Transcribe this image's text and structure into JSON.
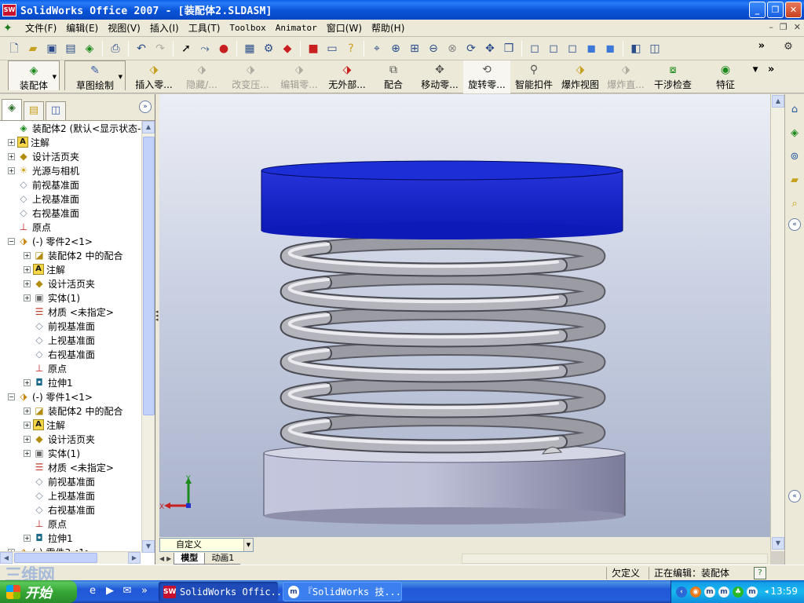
{
  "window": {
    "app_icon": "SW",
    "title": "SolidWorks Office 2007 - [装配体2.SLDASM]",
    "controls": [
      "minimize-icon",
      "restore-icon",
      "close-icon"
    ]
  },
  "menubar": {
    "items": [
      "文件(F)",
      "编辑(E)",
      "视图(V)",
      "插入(I)",
      "工具(T)",
      "Toolbox",
      "Animator",
      "窗口(W)",
      "帮助(H)"
    ]
  },
  "command_manager": {
    "tabs": [
      {
        "label": "装配体",
        "icon": "assembly-icon"
      },
      {
        "label": "草图绘制",
        "icon": "sketch-icon"
      }
    ],
    "commands": [
      {
        "label": "插入零...",
        "icon": "insert-component-icon",
        "enabled": true
      },
      {
        "label": "隐藏/...",
        "icon": "hide-show-icon",
        "enabled": false
      },
      {
        "label": "改变压...",
        "icon": "change-suppression-icon",
        "enabled": false
      },
      {
        "label": "编辑零...",
        "icon": "edit-component-icon",
        "enabled": false
      },
      {
        "label": "无外部...",
        "icon": "no-external-refs-icon",
        "enabled": true
      },
      {
        "label": "配合",
        "icon": "mate-icon",
        "enabled": true
      },
      {
        "label": "移动零...",
        "icon": "move-component-icon",
        "enabled": true
      },
      {
        "label": "旋转零...",
        "icon": "rotate-component-icon",
        "enabled": true
      },
      {
        "label": "智能扣件",
        "icon": "smart-fasteners-icon",
        "enabled": true
      },
      {
        "label": "爆炸视图",
        "icon": "exploded-view-icon",
        "enabled": true
      },
      {
        "label": "爆炸直...",
        "icon": "explode-line-icon",
        "enabled": false
      },
      {
        "label": "干涉检查",
        "icon": "interference-check-icon",
        "enabled": true
      },
      {
        "label": "特征",
        "icon": "features-icon",
        "enabled": true
      }
    ]
  },
  "feature_tree": {
    "rows": [
      {
        "depth": 0,
        "expander": "",
        "icon": "assembly-icon",
        "label": "装配体2  (默认<显示状态-1"
      },
      {
        "depth": 0,
        "expander": "+",
        "icon": "annotations-icon",
        "label": "注解"
      },
      {
        "depth": 0,
        "expander": "+",
        "icon": "design-binder-icon",
        "label": "设计活页夹"
      },
      {
        "depth": 0,
        "expander": "+",
        "icon": "lights-cameras-icon",
        "label": "光源与相机"
      },
      {
        "depth": 0,
        "expander": "",
        "icon": "plane-icon",
        "label": "前视基准面"
      },
      {
        "depth": 0,
        "expander": "",
        "icon": "plane-icon",
        "label": "上视基准面"
      },
      {
        "depth": 0,
        "expander": "",
        "icon": "plane-icon",
        "label": "右视基准面"
      },
      {
        "depth": 0,
        "expander": "",
        "icon": "origin-icon",
        "label": "原点"
      },
      {
        "depth": 0,
        "expander": "−",
        "icon": "part-icon",
        "label": "(-) 零件2<1>"
      },
      {
        "depth": 1,
        "expander": "+",
        "icon": "mates-folder-icon",
        "label": "装配体2 中的配合"
      },
      {
        "depth": 1,
        "expander": "+",
        "icon": "annotations-icon",
        "label": "注解"
      },
      {
        "depth": 1,
        "expander": "+",
        "icon": "design-binder-icon",
        "label": "设计活页夹"
      },
      {
        "depth": 1,
        "expander": "+",
        "icon": "solid-body-icon",
        "label": "实体(1)"
      },
      {
        "depth": 1,
        "expander": "",
        "icon": "material-icon",
        "label": "材质 <未指定>"
      },
      {
        "depth": 1,
        "expander": "",
        "icon": "plane-icon",
        "label": "前视基准面"
      },
      {
        "depth": 1,
        "expander": "",
        "icon": "plane-icon",
        "label": "上视基准面"
      },
      {
        "depth": 1,
        "expander": "",
        "icon": "plane-icon",
        "label": "右视基准面"
      },
      {
        "depth": 1,
        "expander": "",
        "icon": "origin-icon",
        "label": "原点"
      },
      {
        "depth": 1,
        "expander": "+",
        "icon": "extrude-icon",
        "label": "拉伸1"
      },
      {
        "depth": 0,
        "expander": "−",
        "icon": "part-icon",
        "label": "(-) 零件1<1>"
      },
      {
        "depth": 1,
        "expander": "+",
        "icon": "mates-folder-icon",
        "label": "装配体2 中的配合"
      },
      {
        "depth": 1,
        "expander": "+",
        "icon": "annotations-icon",
        "label": "注解"
      },
      {
        "depth": 1,
        "expander": "+",
        "icon": "design-binder-icon",
        "label": "设计活页夹"
      },
      {
        "depth": 1,
        "expander": "+",
        "icon": "solid-body-icon",
        "label": "实体(1)"
      },
      {
        "depth": 1,
        "expander": "",
        "icon": "material-icon",
        "label": "材质 <未指定>"
      },
      {
        "depth": 1,
        "expander": "",
        "icon": "plane-icon",
        "label": "前视基准面"
      },
      {
        "depth": 1,
        "expander": "",
        "icon": "plane-icon",
        "label": "上视基准面"
      },
      {
        "depth": 1,
        "expander": "",
        "icon": "plane-icon",
        "label": "右视基准面"
      },
      {
        "depth": 1,
        "expander": "",
        "icon": "origin-icon",
        "label": "原点"
      },
      {
        "depth": 1,
        "expander": "+",
        "icon": "extrude-icon",
        "label": "拉伸1"
      },
      {
        "depth": 0,
        "expander": "+",
        "icon": "part-icon",
        "label": "(-) 零件3<1>"
      }
    ]
  },
  "viewport": {
    "colors": {
      "top_plate": "#1020c8",
      "bottom_plate": "#c8cbe0",
      "spring": "#b0b0b6"
    },
    "triad": {
      "x": "X",
      "y": "Y"
    }
  },
  "view_bottom": {
    "config_combo": "自定义",
    "tabs": [
      "模型",
      "动画1"
    ]
  },
  "status_bar": {
    "state": "欠定义",
    "editing": "正在编辑：装配体",
    "help": "?"
  },
  "taskbar": {
    "start_label": "开始",
    "tasks": [
      {
        "label": "SolidWorks Offic...",
        "icon": "SW",
        "active": true
      },
      {
        "label": "『SolidWorks 技...",
        "icon": "m",
        "active": false
      }
    ],
    "clock": "13:59"
  },
  "watermark": "三维网"
}
